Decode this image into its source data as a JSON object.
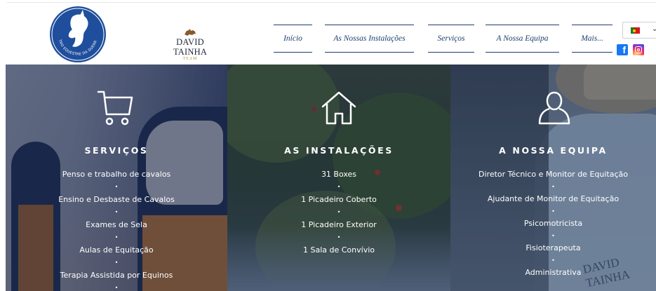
{
  "header": {
    "logo_text": "CENTRO EQUESTRE DA GUERREIRA",
    "brand": {
      "name": "DAVID TAINHA",
      "sub": "TEAM"
    },
    "nav": [
      {
        "label": "Início"
      },
      {
        "label": "As Nossas Instalações"
      },
      {
        "label": "Serviços"
      },
      {
        "label": "A Nossa Equipa"
      },
      {
        "label": "Mais..."
      }
    ],
    "language": {
      "icon": "portugal-flag-icon"
    },
    "social": [
      {
        "icon": "facebook-icon",
        "glyph": "f"
      },
      {
        "icon": "instagram-icon"
      }
    ],
    "colors": {
      "accent": "#1d3d6e"
    }
  },
  "panels": [
    {
      "icon": "shopping-cart-icon",
      "title": "SERVIÇOS",
      "items": [
        "Penso e trabalho de cavalos",
        "Ensino e Desbaste de Cavalos",
        "Exames de Sela",
        "Aulas de Equitação",
        "Terapia Assistida por Equinos"
      ]
    },
    {
      "icon": "house-icon",
      "title": "AS INSTALAÇÕES",
      "items": [
        "31 Boxes",
        "1 Picadeiro Coberto",
        "1 Picadeiro Exterior",
        "1 Sala de Convívio"
      ]
    },
    {
      "icon": "person-icon",
      "title": "A NOSSA EQUIPA",
      "items": [
        "Diretor Técnico e Monitor de Equitação",
        "Ajudante de Monitor de Equitação",
        "Psicomotricista",
        "Fisioterapeuta",
        "Administrativa"
      ],
      "watermark": "DAVID TAINHA"
    }
  ],
  "bullet": "•"
}
